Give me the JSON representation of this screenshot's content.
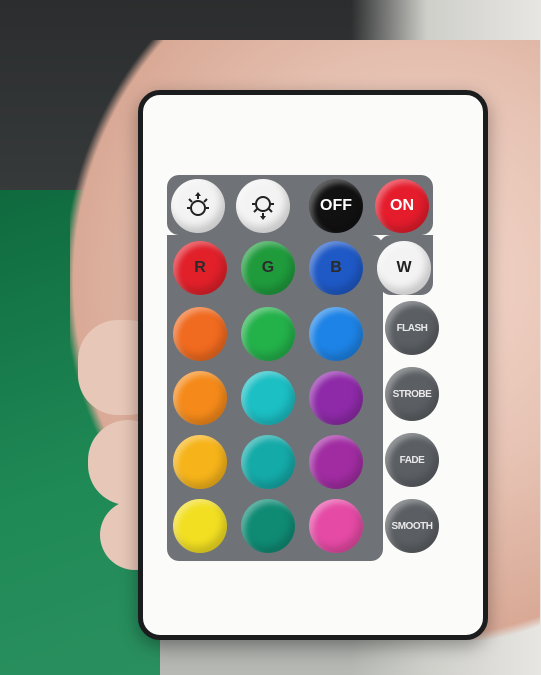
{
  "remote": {
    "buttons": {
      "brightness_up": {
        "icon": "brightness-up-icon"
      },
      "brightness_down": {
        "icon": "brightness-down-icon"
      },
      "off": {
        "label": "OFF"
      },
      "on": {
        "label": "ON"
      },
      "red": {
        "label": "R",
        "color": "#e1202a"
      },
      "green": {
        "label": "G",
        "color": "#1f9b3c"
      },
      "blue": {
        "label": "B",
        "color": "#1e59c6"
      },
      "white": {
        "label": "W",
        "color": "#f4f4f4"
      },
      "flash": {
        "label": "FLASH"
      },
      "strobe": {
        "label": "STROBE"
      },
      "fade": {
        "label": "FADE"
      },
      "smooth": {
        "label": "SMOOTH"
      }
    },
    "color_grid": [
      [
        "#f06a1f",
        "#23b14a",
        "#1d83e6"
      ],
      [
        "#f58a1a",
        "#1bbfc4",
        "#8e2aa8"
      ],
      [
        "#f6b41a",
        "#14aaa8",
        "#a12ca2"
      ],
      [
        "#f2df22",
        "#0f8b74",
        "#e54aa5"
      ]
    ]
  }
}
